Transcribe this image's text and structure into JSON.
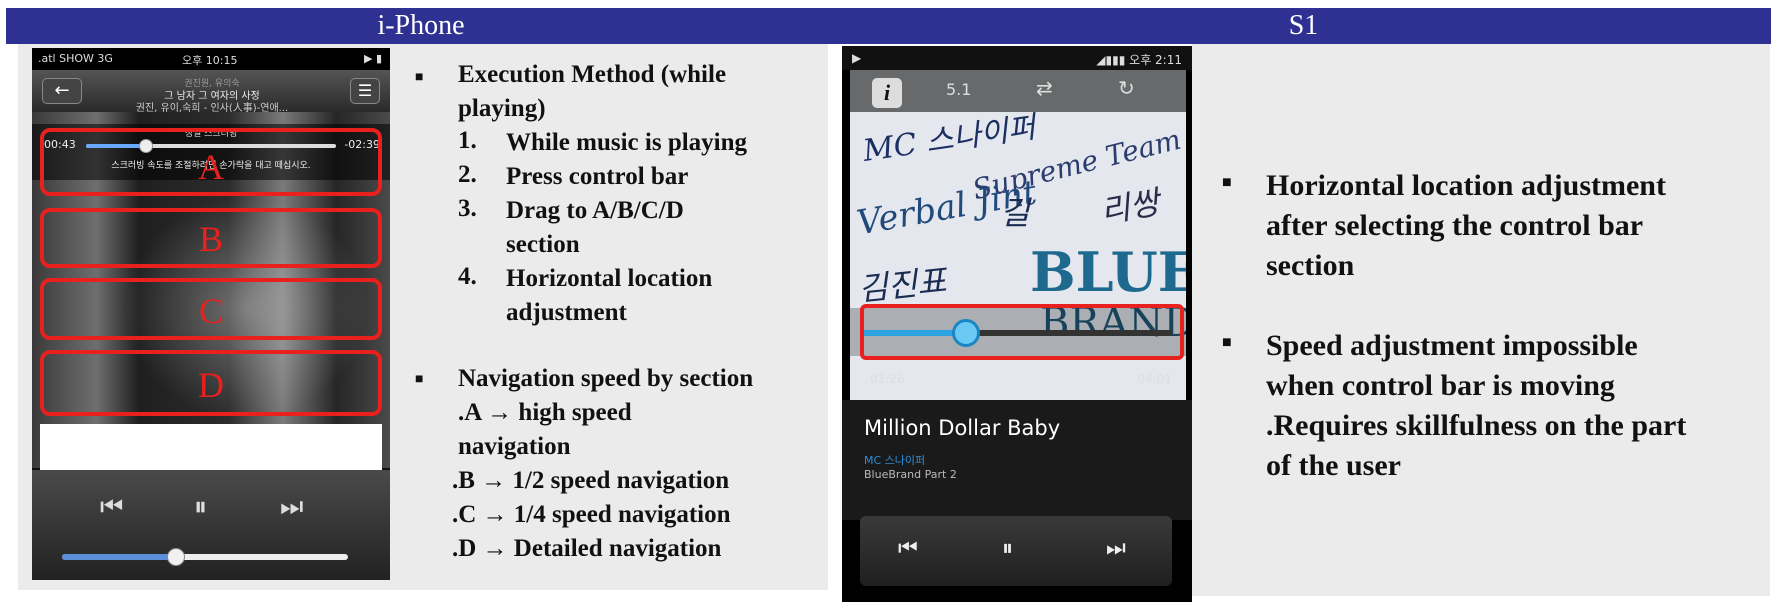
{
  "header": {
    "left_title": "i-Phone",
    "right_title": "S1"
  },
  "iphone": {
    "status": {
      "carrier": ".atl SHOW 3G",
      "time": "오후 10:15",
      "icons": "▶ ▮"
    },
    "nav": {
      "back_icon": "arrow-left-icon",
      "list_icon": "list-icon",
      "artist_line": "권진원, 유의숙",
      "title_line": "그 남자 그 여자의 사정",
      "album_line": "권진, 유이,숙희 - 인사(人事)-연애..."
    },
    "scrub": {
      "label": "정밀 스크러빙",
      "elapsed": "00:43",
      "remaining": "-02:39",
      "progress": 0.24,
      "hint": "스크러빙 속도를 조절하려면 손가락을 대고 떼십시오."
    },
    "zones": [
      "A",
      "B",
      "C",
      "D"
    ],
    "controls": {
      "prev": "⏮",
      "play": "⏸",
      "next": "⏭",
      "volume": 0.4
    }
  },
  "left_text": {
    "execution_title_1": "Execution Method (while",
    "execution_title_2": "playing)",
    "steps": [
      {
        "num": "1.",
        "text": "While music is playing"
      },
      {
        "num": "2.",
        "text": "Press control bar"
      },
      {
        "num": "3.",
        "text": "Drag to A/B/C/D"
      },
      {
        "num": "",
        "text": "section"
      },
      {
        "num": "4.",
        "text": "Horizontal location"
      },
      {
        "num": "",
        "text": "adjustment"
      }
    ],
    "nav_title": "Navigation speed by section",
    "nav_lines": [
      ".A →  high speed",
      "navigation",
      ".B →  1/2 speed navigation",
      ".C →  1/4 speed navigation",
      ".D → Detailed navigation"
    ]
  },
  "s1": {
    "status": {
      "left_icon": "▶",
      "right": "◢▮▮▮ 오후 2:11"
    },
    "topbar": {
      "info_label": "i",
      "sound_label": "5.1",
      "shuffle_icon": "shuffle-icon",
      "repeat_icon": "repeat-icon"
    },
    "art_words": [
      "MC 스나이퍼",
      "Supreme Team",
      "Verbal Jint",
      "BLUE",
      "BRAND",
      "길",
      "김진표",
      "리쌍"
    ],
    "seek": {
      "elapsed": "01:26",
      "total": "04:01",
      "progress": 0.33
    },
    "song": "Million Dollar Baby",
    "artist": "MC 스나이퍼",
    "album": "BlueBrand Part 2",
    "controls": {
      "prev": "⏮",
      "play": "⏸",
      "next": "⏭"
    }
  },
  "right_text": {
    "b1": [
      "Horizontal  location adjustment",
      "after selecting the control bar",
      "section"
    ],
    "b2": [
      "Speed adjustment impossible",
      "when control bar is moving",
      ".Requires skillfulness on the part",
      "of the user"
    ]
  },
  "colors": {
    "header_bg": "#2e3192",
    "zone_red": "#e8211f",
    "panel_bg": "#ebebeb",
    "accent_blue": "#2aa3e0"
  }
}
